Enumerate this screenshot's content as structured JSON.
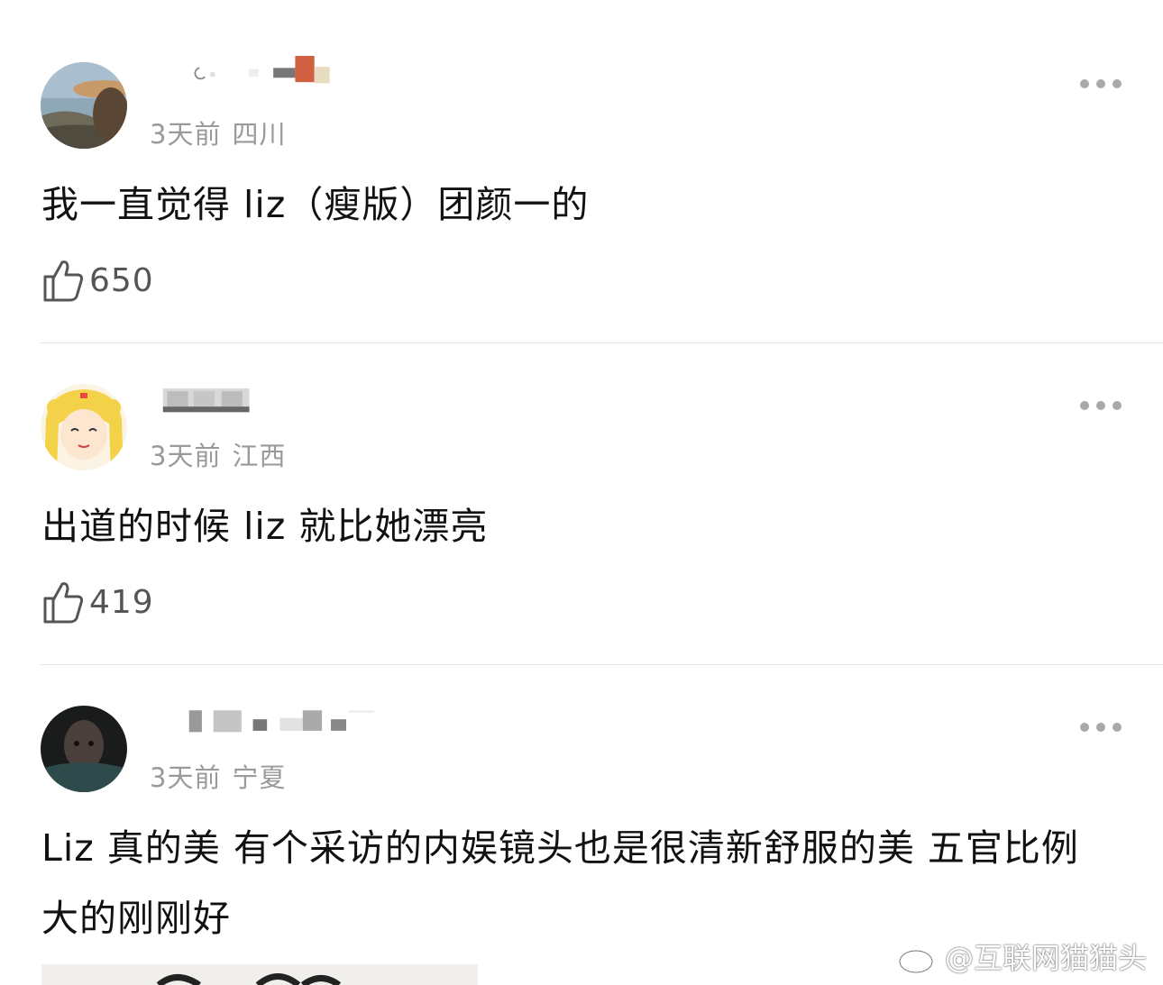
{
  "comments": [
    {
      "time": "3天前",
      "location": "四川",
      "text": "我一直觉得 liz（瘦版）团颜一的",
      "likes": "650"
    },
    {
      "time": "3天前",
      "location": "江西",
      "text": "出道的时候 liz 就比她漂亮",
      "likes": "419"
    },
    {
      "time": "3天前",
      "location": "宁夏",
      "text": "Liz 真的美 有个采访的内娱镜头也是很清新舒服的美  五官比例大的刚刚好",
      "likes": ""
    }
  ],
  "watermark": {
    "text": "@互联网猫猫头"
  },
  "icons": {
    "like": "thumbs-up-icon",
    "more": "more-dots-icon",
    "weibo": "weibo-logo-icon"
  },
  "colors": {
    "meta_text": "#9a9a9a",
    "body_text": "#111111",
    "divider": "#e6e6e6",
    "icon_gray": "#555555"
  }
}
